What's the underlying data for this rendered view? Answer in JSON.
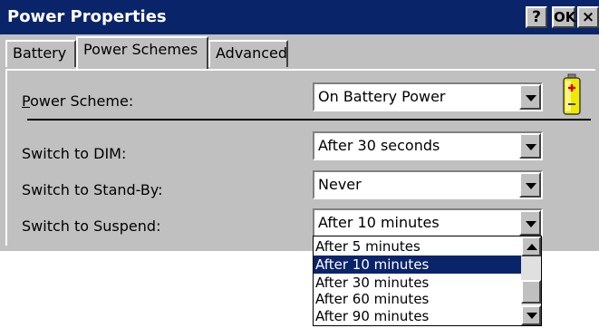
{
  "window": {
    "title": "Power Properties",
    "help_label": "?",
    "ok_label": "OK",
    "close_label": "×"
  },
  "tabs": [
    {
      "label": "Battery"
    },
    {
      "label": "Power Schemes",
      "active": true
    },
    {
      "label": "Advanced"
    }
  ],
  "settings": {
    "power_scheme": {
      "label_prefix": "",
      "label_access": "P",
      "label_rest": "ower Scheme:",
      "value": "On Battery Power"
    },
    "dim": {
      "label": "Switch to DIM:",
      "value": "After 30 seconds"
    },
    "standby": {
      "label": "Switch to Stand-By:",
      "value": "Never"
    },
    "suspend": {
      "label": "Switch to Suspend:",
      "value": "After 10 minutes"
    }
  },
  "dropdown": {
    "options": [
      "After 5 minutes",
      "After 10 minutes",
      "After 30 minutes",
      "After 60 minutes",
      "After 90 minutes"
    ],
    "selected": "After 10 minutes"
  },
  "colors": {
    "title_bar": "#0a246a",
    "selection": "#0a246a",
    "battery_body": "#e8e000",
    "battery_plus": "#d00000"
  },
  "icons": {
    "battery": "battery-icon",
    "dropdown": "chevron-down-icon"
  }
}
